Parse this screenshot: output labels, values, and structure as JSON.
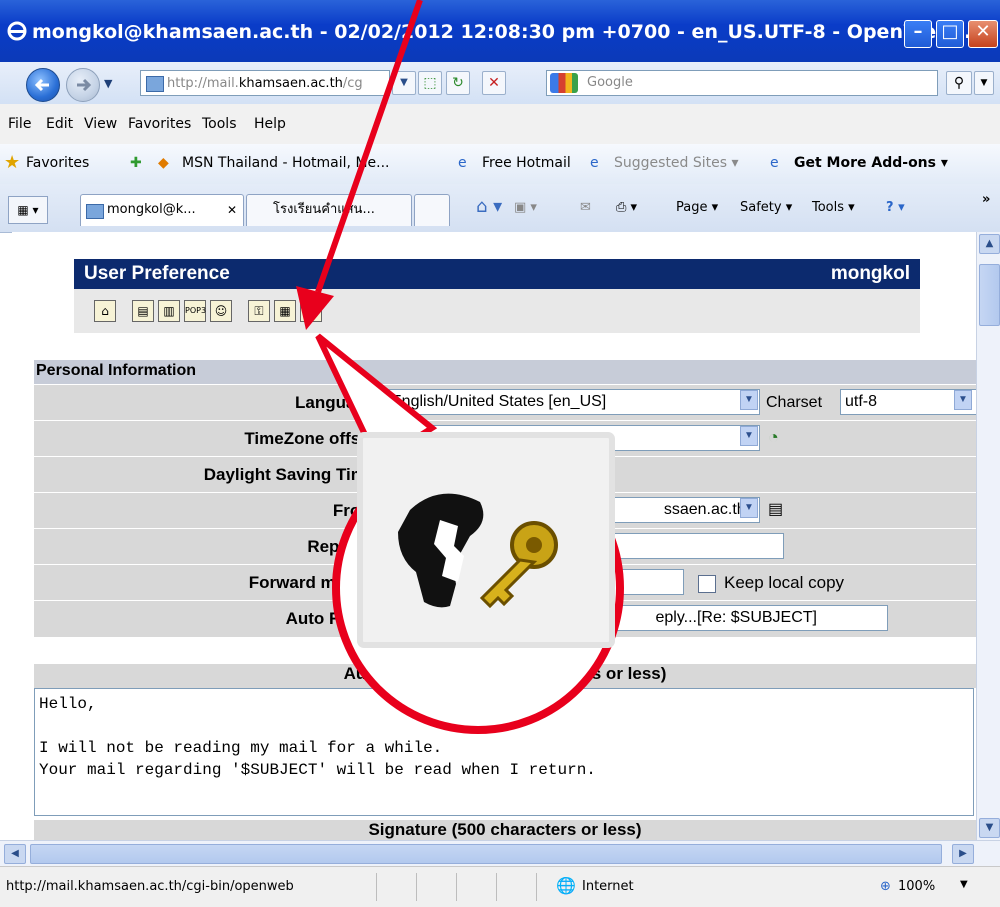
{
  "window": {
    "title": "mongkol@khamsaen.ac.th - 02/02/2012 12:08:30 pm +0700 - en_US.UTF-8 - OpenWeb..."
  },
  "nav": {
    "address_gray": "http://mail.",
    "address_bold": "khamsaen.ac.th",
    "address_tail": "/cg",
    "search_placeholder": "Google"
  },
  "menu": {
    "items": [
      "File",
      "Edit",
      "View",
      "Favorites",
      "Tools",
      "Help"
    ]
  },
  "favorites_bar": {
    "favorites_label": "Favorites",
    "items": [
      "MSN Thailand - Hotmail, Me...",
      "Free Hotmail",
      "Suggested Sites ▾",
      "Get More Add-ons ▾"
    ]
  },
  "tabs": {
    "items": [
      "mongkol@k...",
      "โรงเรียนคำแสน..."
    ],
    "tools": [
      "Page ▾",
      "Safety ▾",
      "Tools ▾"
    ]
  },
  "page": {
    "header_title": "User Preference",
    "header_user": "mongkol",
    "section_personal": "Personal Information",
    "rows": {
      "language": {
        "label": "Language:",
        "value": "English/United States [en_US]",
        "charset_label": "Charset",
        "charset_value": "utf-8"
      },
      "timezone": {
        "label": "TimeZone offset:"
      },
      "daylight": {
        "label": "Daylight Saving Time:"
      },
      "from": {
        "label": "From:",
        "value": "ssaen.ac.th>"
      },
      "replyto": {
        "label": "Reply-to:"
      },
      "forward": {
        "label": "Forward mail to:",
        "keep_copy": "Keep local copy"
      },
      "autoreply": {
        "label": "Auto Reply:",
        "value": "eply...[Re: $SUBJECT]"
      }
    },
    "autoreply_text_label": "Auto Reply Text (500 characters or less)",
    "autoreply_text": "Hello,\n\nI will not be reading my mail for a while.\nYour mail regarding '$SUBJECT' will be read when I return.",
    "signature_label": "Signature (500 characters or less)"
  },
  "status": {
    "url": "http://mail.khamsaen.ac.th/cgi-bin/openweb",
    "zone": "Internet",
    "zoom": "100%"
  },
  "colors": {
    "callout": "#e8001c",
    "header_bg": "#0c2a6e",
    "titlebar": "#0a3cc8"
  }
}
